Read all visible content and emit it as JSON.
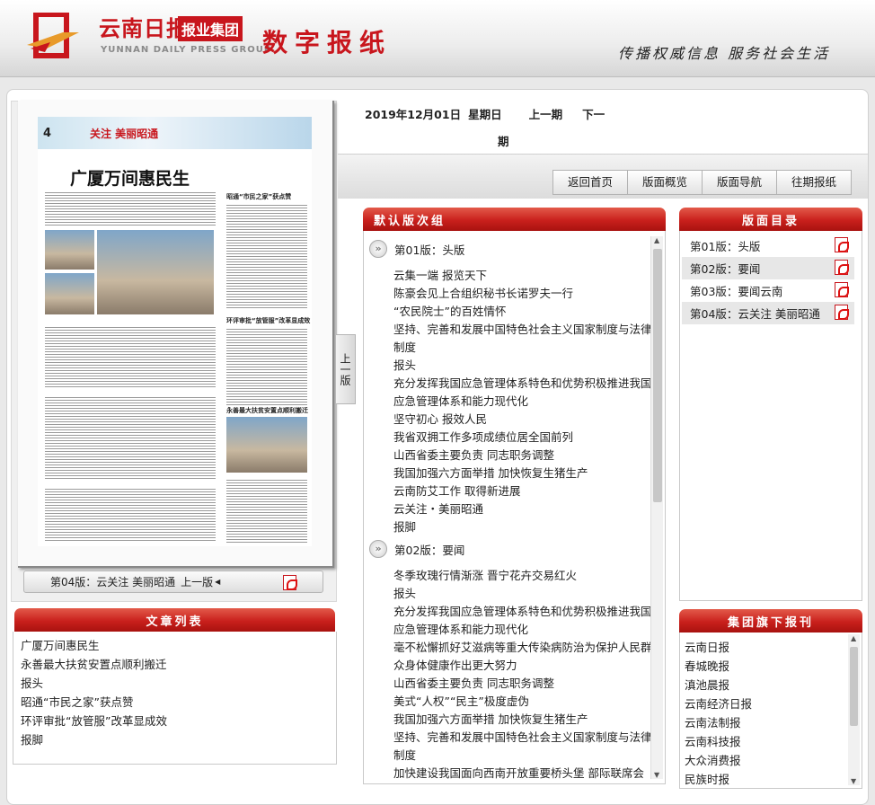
{
  "header": {
    "logo_cn": "云南日报",
    "logo_cn2": "报业集团",
    "logo_en": "YUNNAN DAILY PRESS GROUP",
    "title": "数字报纸",
    "slogan": "传播权威信息 服务社会生活"
  },
  "date_bar": {
    "date": "2019年12月01日",
    "weekday": "星期日",
    "prev_issue": "上一期",
    "next_issue_a": "下一",
    "next_issue_b": "期"
  },
  "nav_buttons": [
    "返回首页",
    "版面概览",
    "版面导航",
    "往期报纸"
  ],
  "newspaper": {
    "page_number": "4",
    "banner": "关注 美丽昭通",
    "headline": "广厦万间惠民生",
    "subhead_1": "昭通“市民之家”获点赞",
    "subhead_2": "环评审批“放管服”改革显成效",
    "subhead_3": "永善最大扶贫安置点顺利搬迁"
  },
  "prev_page_tab": "上一版",
  "pager": {
    "label": "第04版：云关注 美丽昭通",
    "prev": "上一版"
  },
  "article_list": {
    "title": "文章列表",
    "items": [
      "广厦万间惠民生",
      "永善最大扶贫安置点顺利搬迁",
      "报头",
      "昭通“市民之家”获点赞",
      "环评审批“放管服”改革显成效",
      "报脚"
    ]
  },
  "toc": {
    "title": "默认版次组",
    "sections": [
      {
        "head": "第01版：头版",
        "items": [
          "云集一端 报览天下",
          "陈豪会见上合组织秘书长诺罗夫一行",
          "“农民院士”的百姓情怀",
          "坚持、完善和发展中国特色社会主义国家制度与法律",
          "制度",
          "报头",
          "充分发挥我国应急管理体系特色和优势积极推进我国",
          "应急管理体系和能力现代化",
          "坚守初心 报效人民",
          "我省双拥工作多项成绩位居全国前列",
          "山西省委主要负责 同志职务调整",
          "我国加强六方面举措 加快恢复生猪生产",
          "云南防艾工作 取得新进展",
          "云关注・美丽昭通",
          "报脚"
        ]
      },
      {
        "head": "第02版：要闻",
        "items": [
          "冬季玫瑰行情渐涨 晋宁花卉交易红火",
          "报头",
          "充分发挥我国应急管理体系特色和优势积极推进我国",
          "应急管理体系和能力现代化",
          "毫不松懈抓好艾滋病等重大传染病防治为保护人民群",
          "众身体健康作出更大努力",
          "山西省委主要负责 同志职务调整",
          "美式“人权”“民主”极度虚伪",
          "我国加强六方面举措 加快恢复生猪生产",
          "坚持、完善和发展中国特色社会主义国家制度与法律",
          "制度",
          "加快建设我国面向西南开放重要桥头堡 部际联席会"
        ]
      }
    ]
  },
  "page_directory": {
    "title": "版面目录",
    "items": [
      "第01版：头版",
      "第02版：要闻",
      "第03版：要闻云南",
      "第04版：云关注 美丽昭通"
    ]
  },
  "group_papers": {
    "title": "集团旗下报刊",
    "items": [
      "云南日报",
      "春城晚报",
      "滇池晨报",
      "云南经济日报",
      "云南法制报",
      "云南科技报",
      "大众消费报",
      "民族时报"
    ]
  }
}
